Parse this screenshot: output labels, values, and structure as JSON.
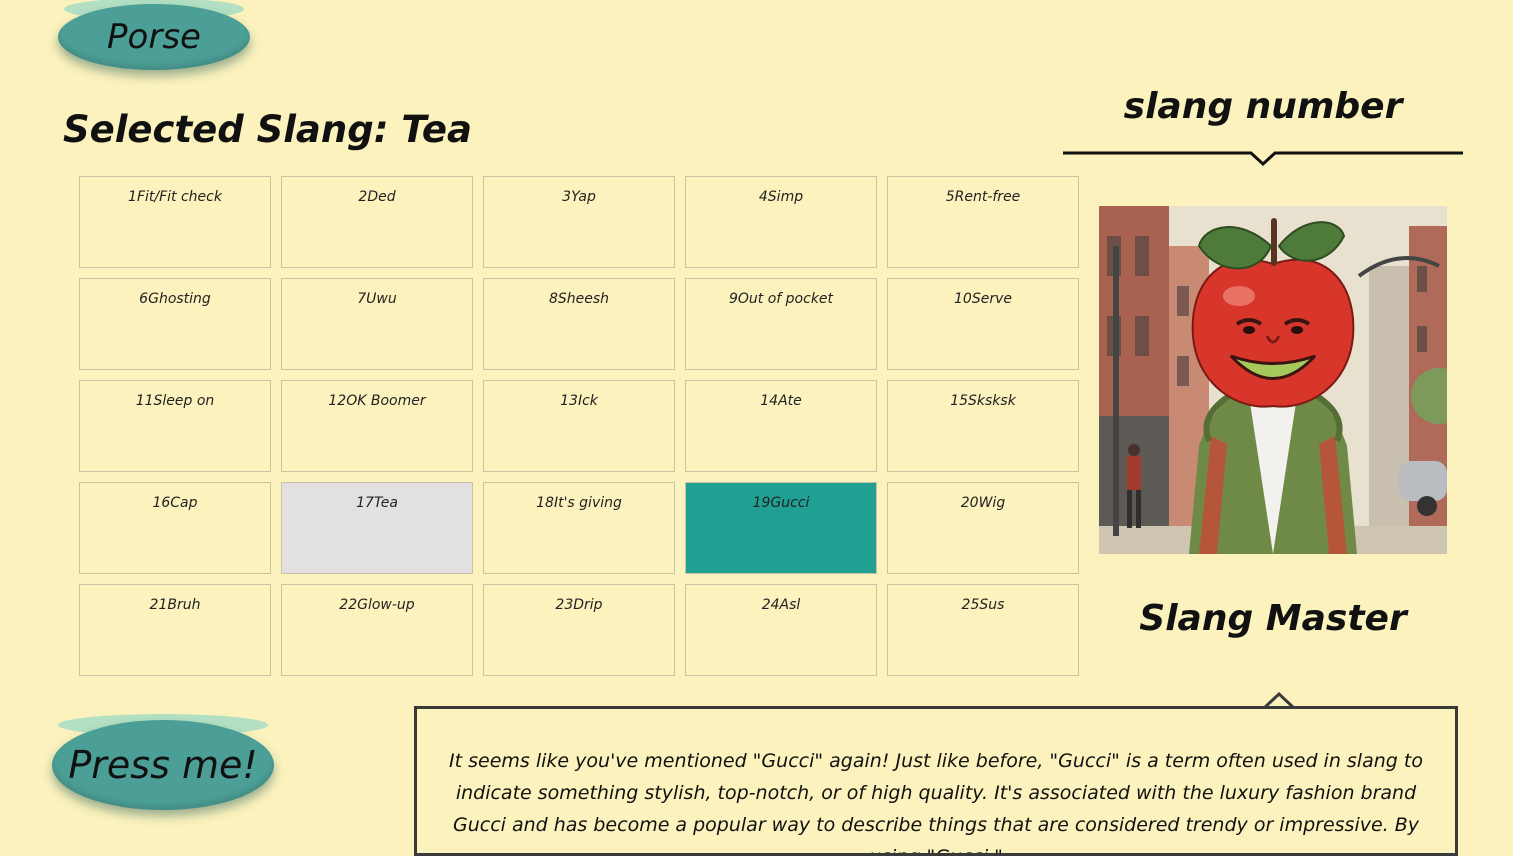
{
  "buttons": {
    "parse_label": "Porse",
    "press_label": "Press me!"
  },
  "selected": {
    "prefix": "Selected Slang: ",
    "value": "Tea"
  },
  "grid": {
    "cells": [
      {
        "num": "1",
        "term": "Fit/Fit check"
      },
      {
        "num": "2",
        "term": "Ded"
      },
      {
        "num": "3",
        "term": "Yap"
      },
      {
        "num": "4",
        "term": "Simp"
      },
      {
        "num": "5",
        "term": "Rent-free"
      },
      {
        "num": "6",
        "term": "Ghosting"
      },
      {
        "num": "7",
        "term": "Uwu"
      },
      {
        "num": "8",
        "term": "Sheesh"
      },
      {
        "num": "9",
        "term": "Out of pocket"
      },
      {
        "num": "10",
        "term": "Serve"
      },
      {
        "num": "11",
        "term": "Sleep on"
      },
      {
        "num": "12",
        "term": "OK Boomer"
      },
      {
        "num": "13",
        "term": "Ick"
      },
      {
        "num": "14",
        "term": "Ate"
      },
      {
        "num": "15",
        "term": "Sksksk"
      },
      {
        "num": "16",
        "term": "Cap"
      },
      {
        "num": "17",
        "term": "Tea"
      },
      {
        "num": "18",
        "term": "It's giving"
      },
      {
        "num": "19",
        "term": "Gucci"
      },
      {
        "num": "20",
        "term": "Wig"
      },
      {
        "num": "21",
        "term": "Bruh"
      },
      {
        "num": "22",
        "term": "Glow-up"
      },
      {
        "num": "23",
        "term": "Drip"
      },
      {
        "num": "24",
        "term": "Asl"
      },
      {
        "num": "25",
        "term": "Sus"
      }
    ],
    "selected_num": "17",
    "active_num": "19"
  },
  "sidebar": {
    "number_label": "slang number",
    "master_label": "Slang Master",
    "avatar_icon": "apple-character-icon"
  },
  "reply": {
    "text": "It seems like you've mentioned \"Gucci\" again! Just like before, \"Gucci\" is a term often used in slang to indicate something stylish, top-notch, or of high quality. It's associated with the luxury fashion brand Gucci and has become a popular way to describe things that are considered trendy or impressive. By using \"Gucci,\""
  },
  "colors": {
    "background": "#fbf2bd",
    "button": "#4b9f97",
    "active_cell": "#1fa093",
    "selected_cell": "#e2e0e0"
  }
}
